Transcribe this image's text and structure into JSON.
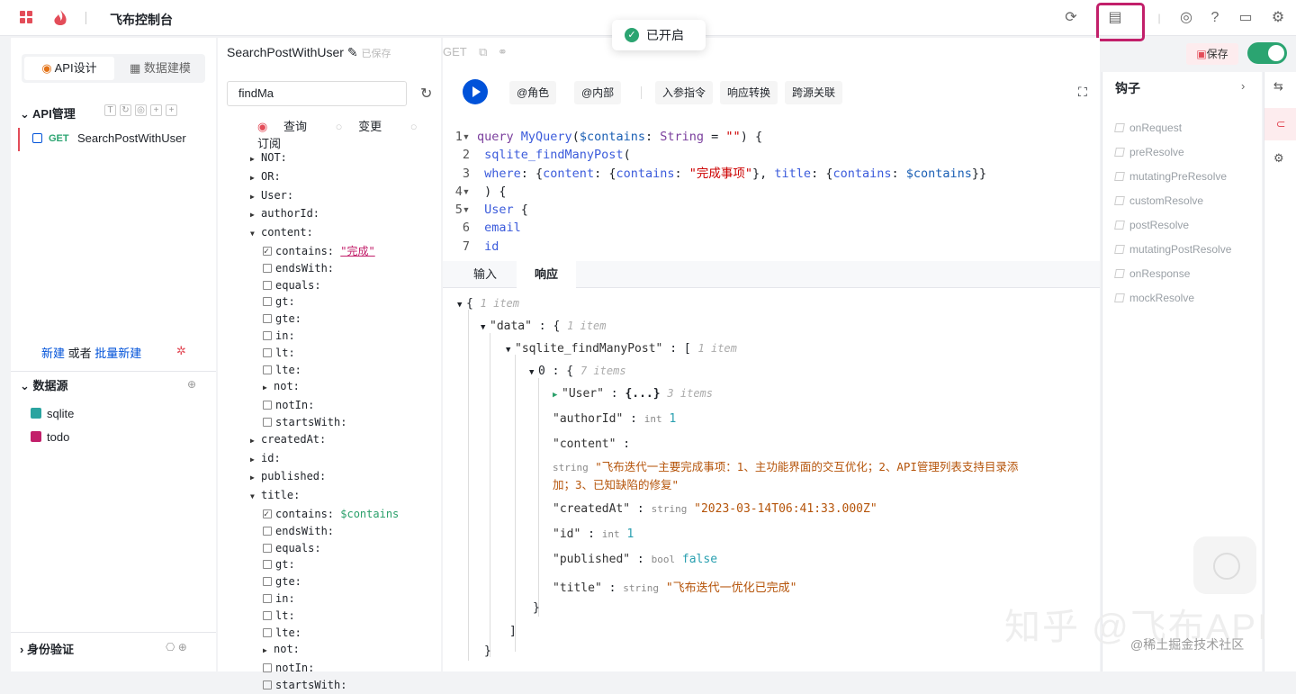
{
  "app": {
    "title": "飞布控制台"
  },
  "toast": {
    "text": "已开启"
  },
  "left": {
    "tab_api": "API设计",
    "tab_data": "数据建模",
    "api_section": "API管理",
    "api_method": "GET",
    "api_name": "SearchPostWithUser",
    "new_link": "新建",
    "or_text": "或者",
    "batch_link": "批量新建",
    "ds_section": "数据源",
    "datasources": [
      "sqlite",
      "todo"
    ],
    "auth_section": "身份验证"
  },
  "editor": {
    "op_name": "SearchPostWithUser",
    "saved_state": "已保存",
    "method": "GET",
    "save_label": "保存",
    "tool_role": "@角色",
    "tool_internal": "@内部",
    "tool_input": "入参指令",
    "tool_resp": "响应转换",
    "tool_cross": "跨源关联",
    "tab_input": "输入",
    "tab_response": "响应"
  },
  "explorer": {
    "search_value": "findMa",
    "radio_query": "查询",
    "radio_mutation": "变更",
    "radio_sub": "订阅"
  },
  "code_lines": [
    "query MyQuery($contains: String = \"\") {",
    "  sqlite_findManyPost(",
    "    where: {content: {contains: \"完成事项\"}, title: {contains: $contains}}",
    "  ) {",
    "    User {",
    "      email",
    "      id"
  ],
  "json_view": {
    "root_meta": "1 item",
    "data_key": "\"data\"",
    "data_meta": "1 item",
    "find_key": "\"sqlite_findManyPost\"",
    "find_meta": "1 item",
    "idx": "0",
    "idx_meta": "7 items",
    "user_key": "\"User\"",
    "user_val": "{...}",
    "user_meta": "3 items",
    "authorId_key": "\"authorId\"",
    "authorId_type": "int",
    "authorId_val": "1",
    "content_key": "\"content\"",
    "content_type": "string",
    "content_val1": "\"飞布迭代一主要完成事项：1、主功能界面的交互优化；2、API管理列表支持目录添",
    "content_val2": "加；3、已知缺陷的修复\"",
    "createdAt_key": "\"createdAt\"",
    "createdAt_type": "string",
    "createdAt_val": "\"2023-03-14T06:41:33.000Z\"",
    "id_key": "\"id\"",
    "id_type": "int",
    "id_val": "1",
    "published_key": "\"published\"",
    "published_type": "bool",
    "published_val": "false",
    "title_key": "\"title\"",
    "title_type": "string",
    "title_val": "\"飞布迭代一优化已完成\""
  },
  "hooks": {
    "title": "钩子",
    "items": [
      "onRequest",
      "preResolve",
      "mutatingPreResolve",
      "customResolve",
      "postResolve",
      "mutatingPostResolve",
      "onResponse",
      "mockResolve"
    ]
  },
  "watermark": {
    "main": "知乎 @飞布API",
    "sub": "@稀土掘金技术社区"
  }
}
